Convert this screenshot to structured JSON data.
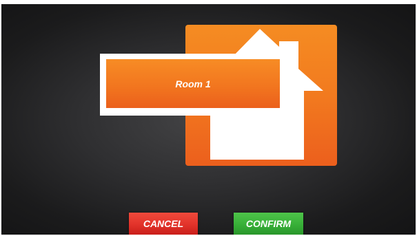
{
  "room": {
    "name": "Room 1",
    "icon": "house-icon"
  },
  "actions": {
    "cancel_label": "CANCEL",
    "confirm_label": "CONFIRM"
  },
  "colors": {
    "background": "#2f2f31",
    "tile_orange": "#f27a1f",
    "cancel_red": "#e2332a",
    "confirm_green": "#38b038",
    "house_white": "#ffffff"
  }
}
